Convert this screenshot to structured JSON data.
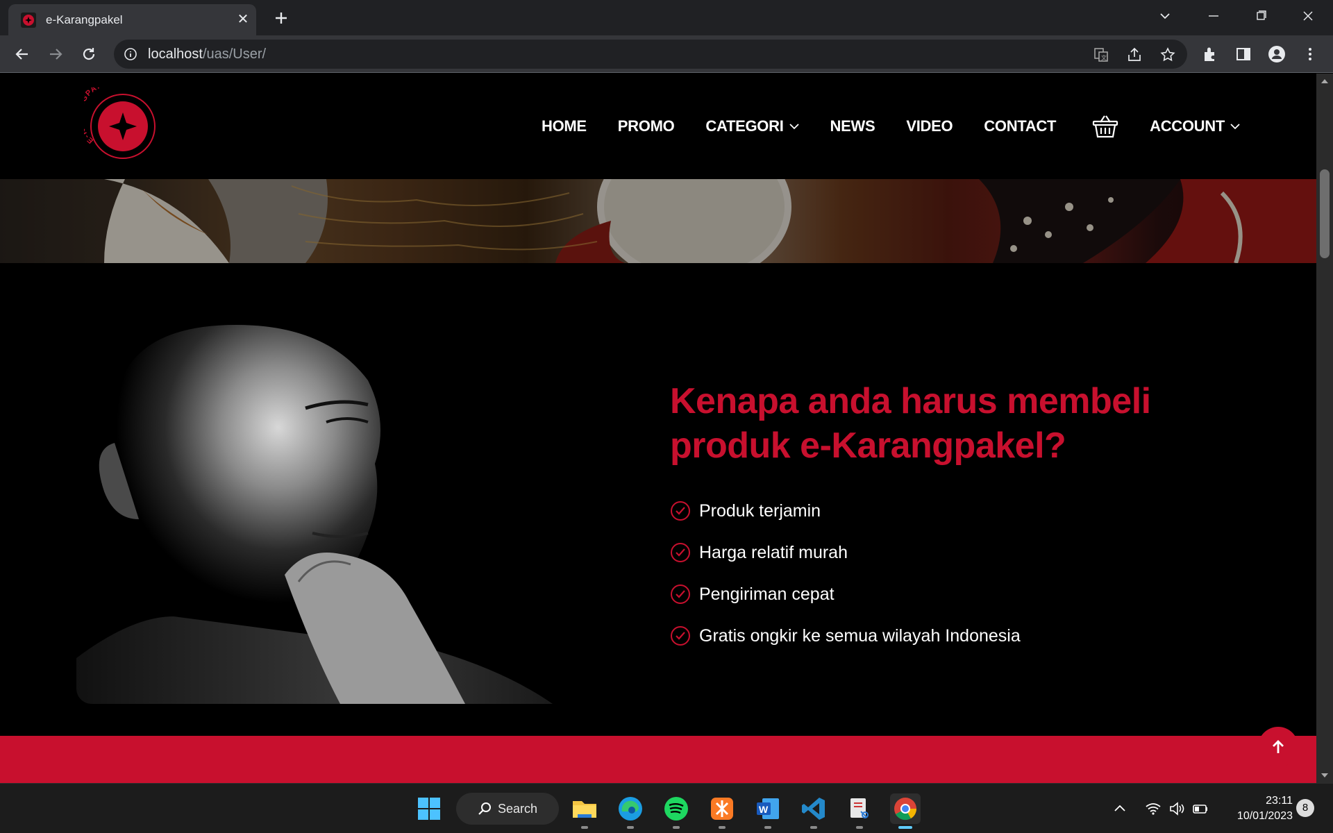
{
  "browser": {
    "tab_title": "e-Karangpakel",
    "url_host": "localhost",
    "url_path": "/uas/User/"
  },
  "site": {
    "logo_text": "E-KARANGPAKEL",
    "nav": {
      "home": "HOME",
      "promo": "PROMO",
      "categori": "CATEGORI",
      "news": "NEWS",
      "video": "VIDEO",
      "contact": "CONTACT",
      "account": "ACCOUNT"
    },
    "icons": {
      "cart": "basket-icon",
      "to_top": "arrow-up-icon",
      "check": "check-circle-icon"
    },
    "headline": "Kenapa anda harus membeli produk e-Karangpakel?",
    "features": [
      "Produk terjamin",
      "Harga relatif murah",
      "Pengiriman cepat",
      "Gratis ongkir ke semua wilayah Indonesia"
    ],
    "colors": {
      "accent": "#c8102e",
      "background": "#000000"
    }
  },
  "taskbar": {
    "search_label": "Search",
    "time": "23:11",
    "date": "10/01/2023",
    "notification_count": "8"
  }
}
